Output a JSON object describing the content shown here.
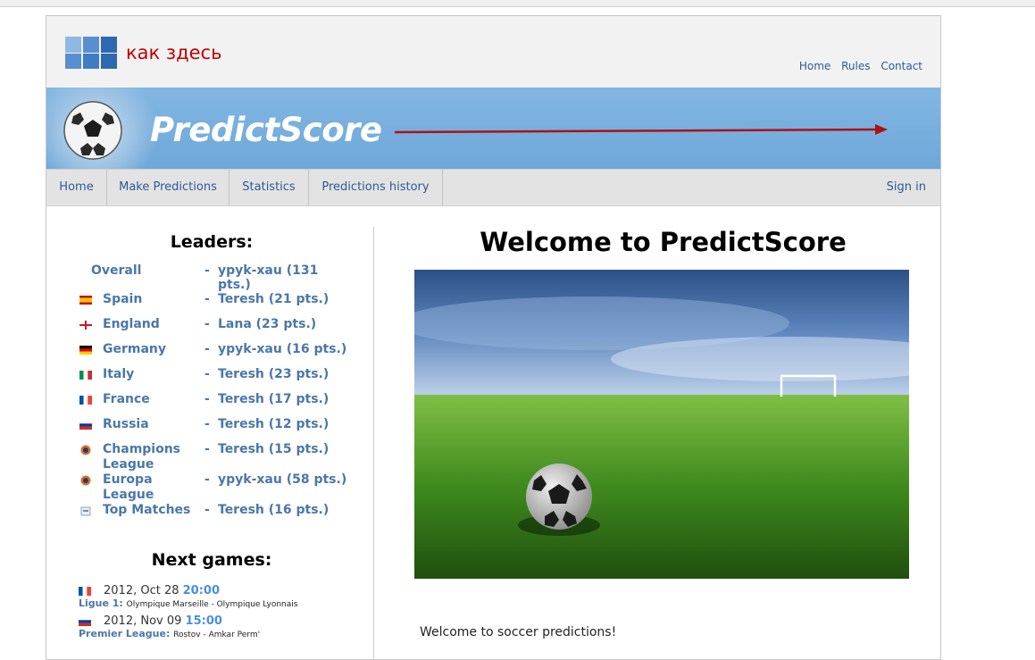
{
  "header": {
    "logo_text": "как здесь",
    "links": [
      {
        "label": "Home"
      },
      {
        "label": "Rules"
      },
      {
        "label": "Contact"
      }
    ]
  },
  "banner": {
    "brand": "PredictScore"
  },
  "nav": {
    "items": [
      {
        "label": "Home"
      },
      {
        "label": "Make Predictions"
      },
      {
        "label": "Statistics"
      },
      {
        "label": "Predictions history"
      }
    ],
    "sign_in": "Sign in"
  },
  "leaders": {
    "title": "Leaders:",
    "rows": [
      {
        "name": "Overall",
        "leader": "ypyk-xau (131 pts.)",
        "flag": "none"
      },
      {
        "name": "Spain",
        "leader": "Teresh (21 pts.)",
        "flag": "spain-flag"
      },
      {
        "name": "England",
        "leader": "Lana (23 pts.)",
        "flag": "england-flag"
      },
      {
        "name": "Germany",
        "leader": "ypyk-xau (16 pts.)",
        "flag": "germany-flag"
      },
      {
        "name": "Italy",
        "leader": "Teresh (23 pts.)",
        "flag": "italy-flag"
      },
      {
        "name": "France",
        "leader": "Teresh (17 pts.)",
        "flag": "france-flag"
      },
      {
        "name": "Russia",
        "leader": "Teresh (12 pts.)",
        "flag": "russia-flag"
      },
      {
        "name": "Champions League",
        "leader": "Teresh (15 pts.)",
        "flag": "uefa-icon"
      },
      {
        "name": "Europa League",
        "leader": "ypyk-xau (58 pts.)",
        "flag": "uefa-icon"
      },
      {
        "name": "Top Matches",
        "leader": "Teresh (16 pts.)",
        "flag": "top-matches-icon"
      }
    ]
  },
  "next_games": {
    "title": "Next games:",
    "games": [
      {
        "date": "2012, Oct 28",
        "time": "20:00",
        "league": "Ligue 1:",
        "teams": "Olympique Marseille - Olympique Lyonnais",
        "flag": "france-flag"
      },
      {
        "date": "2012, Nov 09",
        "time": "15:00",
        "league": "Premier League:",
        "teams": "Rostov - Amkar Perm'",
        "flag": "russia-flag"
      }
    ]
  },
  "main": {
    "title": "Welcome to PredictScore",
    "welcome_text": "Welcome to soccer predictions!"
  },
  "colors": {
    "accent": "#2a5a9a",
    "logo_red": "#c00000",
    "banner_blue": "#7db3e0",
    "link_blue": "#4a77a8"
  }
}
